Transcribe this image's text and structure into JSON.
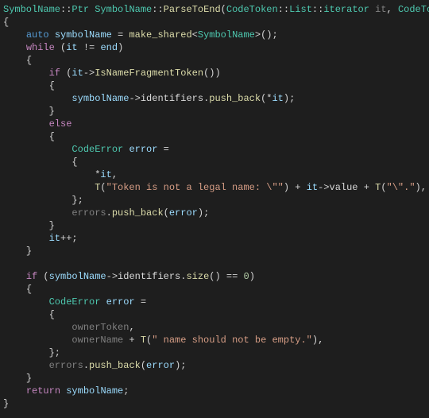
{
  "code": {
    "l1": {
      "t1": "SymbolName",
      "t2": "::",
      "t3": "Ptr",
      "t4": " ",
      "t5": "SymbolName",
      "t6": "::",
      "t7": "ParseToEnd",
      "t8": "(",
      "t9": "CodeToken",
      "t10": "::",
      "t11": "List",
      "t12": "::",
      "t13": "iterator",
      "t14": " ",
      "t15": "it",
      "t16": ", ",
      "t17": "CodeTok"
    },
    "l2": {
      "t1": "{"
    },
    "l3": {
      "t1": "auto",
      "t2": " ",
      "t3": "symbolName",
      "t4": " = ",
      "t5": "make_shared",
      "t6": "<",
      "t7": "SymbolName",
      "t8": ">();"
    },
    "l4": {
      "t1": "while",
      "t2": " (",
      "t3": "it",
      "t4": " != ",
      "t5": "end",
      "t6": ")"
    },
    "l5": {
      "t1": "{"
    },
    "l6": {
      "t1": "if",
      "t2": " (",
      "t3": "it",
      "t4": "->",
      "t5": "IsNameFragmentToken",
      "t6": "())"
    },
    "l7": {
      "t1": "{"
    },
    "l8": {
      "t1": "symbolName",
      "t2": "->",
      "t3": "identifiers",
      "t4": ".",
      "t5": "push_back",
      "t6": "(*",
      "t7": "it",
      "t8": ");"
    },
    "l9": {
      "t1": "}"
    },
    "l10": {
      "t1": "else"
    },
    "l11": {
      "t1": "{"
    },
    "l12": {
      "t1": "CodeError",
      "t2": " ",
      "t3": "error",
      "t4": " ="
    },
    "l13": {
      "t1": "{"
    },
    "l14": {
      "t1": "*",
      "t2": "it",
      "t3": ","
    },
    "l15": {
      "t1": "T",
      "t2": "(",
      "t3": "\"Token is not a legal name: \\\"\"",
      "t4": ") + ",
      "t5": "it",
      "t6": "->",
      "t7": "value",
      "t8": " + ",
      "t9": "T",
      "t10": "(",
      "t11": "\"\\\".\"",
      "t12": "),"
    },
    "l16": {
      "t1": "};"
    },
    "l17": {
      "t1": "errors",
      "t2": ".",
      "t3": "push_back",
      "t4": "(",
      "t5": "error",
      "t6": ");"
    },
    "l18": {
      "t1": "}"
    },
    "l19": {
      "t1": "it",
      "t2": "++;"
    },
    "l20": {
      "t1": "}"
    },
    "l21": {
      "t1": "if",
      "t2": " (",
      "t3": "symbolName",
      "t4": "->",
      "t5": "identifiers",
      "t6": ".",
      "t7": "size",
      "t8": "() == ",
      "t9": "0",
      "t10": ")"
    },
    "l22": {
      "t1": "{"
    },
    "l23": {
      "t1": "CodeError",
      "t2": " ",
      "t3": "error",
      "t4": " ="
    },
    "l24": {
      "t1": "{"
    },
    "l25": {
      "t1": "ownerToken",
      "t2": ","
    },
    "l26": {
      "t1": "ownerName",
      "t2": " + ",
      "t3": "T",
      "t4": "(",
      "t5": "\" name should not be empty.\"",
      "t6": "),"
    },
    "l27": {
      "t1": "};"
    },
    "l28": {
      "t1": "errors",
      "t2": ".",
      "t3": "push_back",
      "t4": "(",
      "t5": "error",
      "t6": ");"
    },
    "l29": {
      "t1": "}"
    },
    "l30": {
      "t1": "return",
      "t2": " ",
      "t3": "symbolName",
      "t4": ";"
    },
    "l31": {
      "t1": "}"
    }
  }
}
